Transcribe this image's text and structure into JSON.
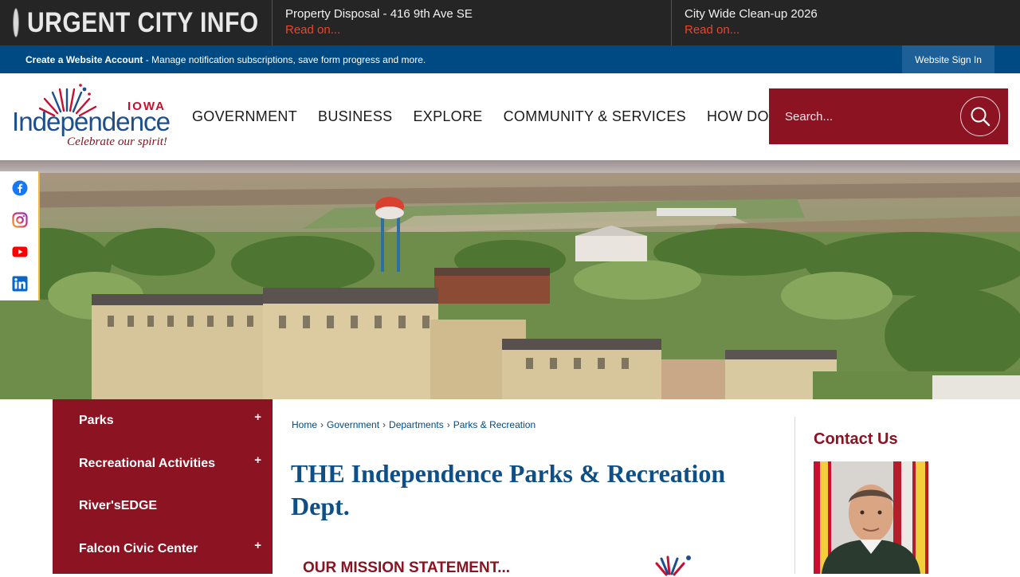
{
  "alert": {
    "title": "URGENT CITY INFO",
    "items": [
      {
        "title": "Property Disposal - 416 9th Ave SE",
        "link": "Read on..."
      },
      {
        "title": "City Wide Clean-up 2026",
        "link": "Read on..."
      }
    ]
  },
  "account": {
    "create_label": "Create a Website Account",
    "description": " - Manage notification subscriptions, save form progress and more.",
    "signin_label": "Website Sign In"
  },
  "logo": {
    "state": "IOWA",
    "name": "Independence",
    "tagline": "Celebrate our spirit!"
  },
  "nav": {
    "items": [
      "GOVERNMENT",
      "BUSINESS",
      "EXPLORE",
      "COMMUNITY & SERVICES",
      "HOW DO I..."
    ]
  },
  "search": {
    "placeholder": "Search..."
  },
  "social": [
    "facebook-icon",
    "instagram-icon",
    "youtube-icon",
    "linkedin-icon"
  ],
  "side_menu": {
    "items": [
      {
        "label": "Parks",
        "expandable": "+"
      },
      {
        "label": "Recreational Activities",
        "expandable": "+"
      },
      {
        "label": "River'sEDGE",
        "expandable": ""
      },
      {
        "label": "Falcon Civic Center",
        "expandable": "+"
      }
    ]
  },
  "breadcrumb": {
    "items": [
      "Home",
      "Government",
      "Departments",
      "Parks & Recreation"
    ],
    "separator": "›"
  },
  "main": {
    "title": "THE Independence Parks & Recreation Dept.",
    "mission_heading": "OUR MISSION STATEMENT..."
  },
  "contact": {
    "title": "Contact Us"
  },
  "colors": {
    "brand_maroon": "#8b1322",
    "brand_blue": "#004a84",
    "alert_link": "#e8472b"
  }
}
